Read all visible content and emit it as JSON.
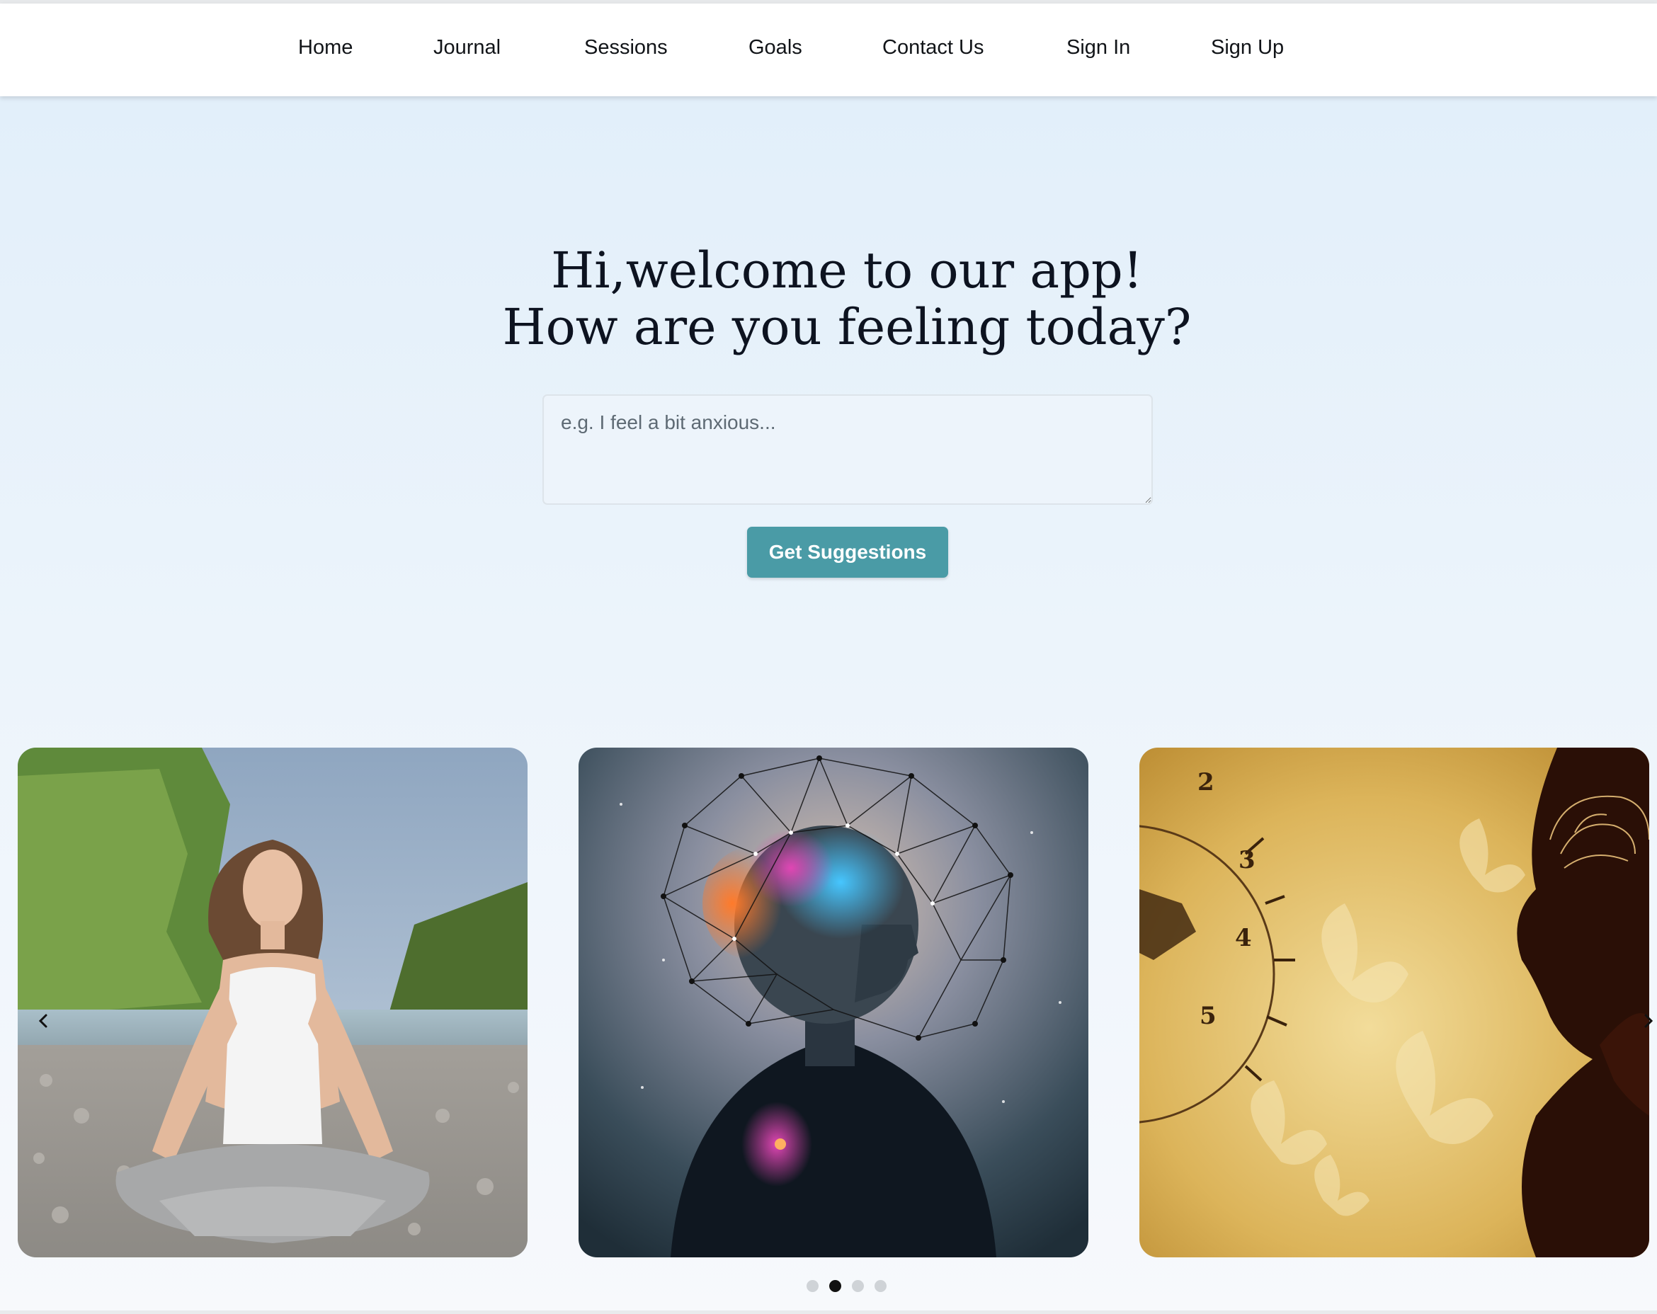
{
  "nav": {
    "items": [
      {
        "label": "Home"
      },
      {
        "label": "Journal"
      },
      {
        "label": "Sessions"
      },
      {
        "label": "Goals"
      },
      {
        "label": "Contact Us"
      },
      {
        "label": "Sign In"
      },
      {
        "label": "Sign Up"
      }
    ]
  },
  "hero": {
    "title_line1": "Hi,welcome to our app!",
    "title_line2": "How are you feeling today?",
    "input_placeholder": "e.g. I feel a bit anxious...",
    "input_value": "",
    "button_label": "Get Suggestions"
  },
  "carousel": {
    "slides": [
      {
        "image": "woman-meditating-on-river-pebbles-photo"
      },
      {
        "image": "glowing-neural-network-head-illustration"
      },
      {
        "image": "clock-butterflies-brain-silhouette-illustration"
      }
    ],
    "prev_icon": "chevron-left-icon",
    "next_icon": "chevron-right-icon",
    "dot_count": 4,
    "active_dot": 2
  },
  "colors": {
    "accent": "#4a9ba6",
    "hero_background": "#e2effa",
    "text_dark": "#0d1320"
  }
}
